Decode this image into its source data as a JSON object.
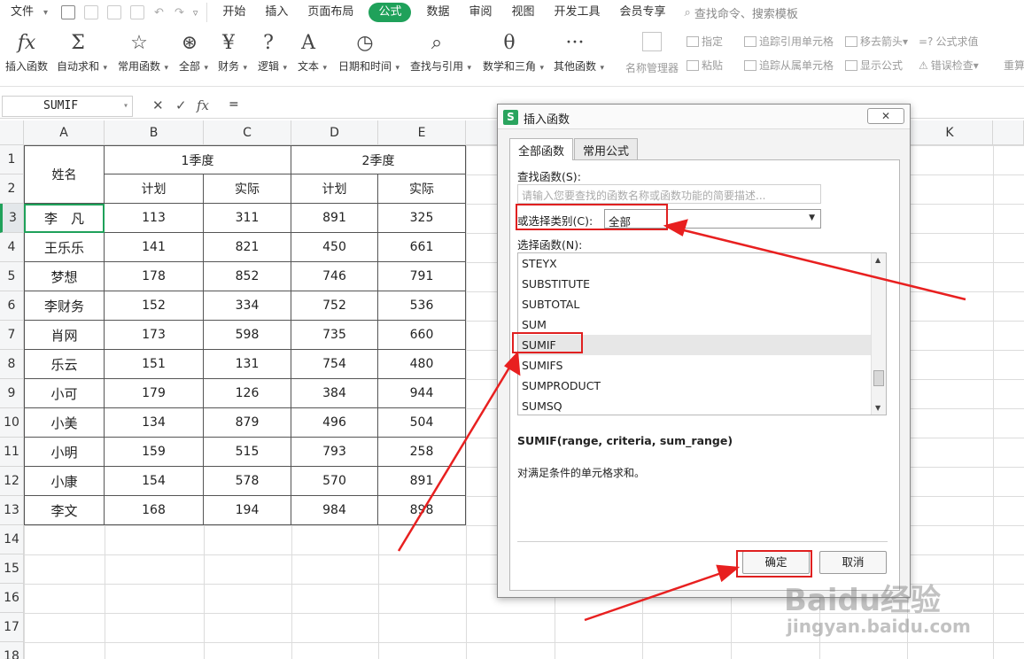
{
  "menubar": {
    "file": "文件",
    "tabs": [
      "开始",
      "插入",
      "页面布局",
      "公式",
      "数据",
      "审阅",
      "视图",
      "开发工具",
      "会员专享"
    ],
    "active_tab": "公式",
    "search": "查找命令、搜索模板"
  },
  "ribbon": {
    "buttons": [
      {
        "icon": "fx",
        "label": "插入函数"
      },
      {
        "icon": "Σ",
        "label": "自动求和"
      },
      {
        "icon": "☆",
        "label": "常用函数"
      },
      {
        "icon": "⊛",
        "label": "全部"
      },
      {
        "icon": "¥",
        "label": "财务"
      },
      {
        "icon": "?",
        "label": "逻辑"
      },
      {
        "icon": "A",
        "label": "文本"
      },
      {
        "icon": "◷",
        "label": "日期和时间"
      },
      {
        "icon": "⌕",
        "label": "查找与引用"
      },
      {
        "icon": "θ",
        "label": "数学和三角"
      },
      {
        "icon": "···",
        "label": "其他函数"
      }
    ],
    "name_manager": "名称管理器",
    "specify": "指定",
    "paste": "粘贴",
    "trace_precedents": "追踪引用单元格",
    "trace_dependents": "追踪从属单元格",
    "remove_arrows": "移去箭头",
    "show_formulas": "显示公式",
    "evaluate": "公式求值",
    "error_check": "错误检查",
    "recalc": "重算"
  },
  "formula_bar": {
    "name_box": "SUMIF",
    "value": "="
  },
  "sheet": {
    "columns": [
      "A",
      "B",
      "C",
      "D",
      "E",
      "K"
    ],
    "rows": [
      "1",
      "2",
      "3",
      "4",
      "5",
      "6",
      "7",
      "8",
      "9",
      "10",
      "11",
      "12",
      "13",
      "14",
      "15",
      "16",
      "17",
      "18"
    ],
    "header_name": "姓名",
    "q1": "1季度",
    "q2": "2季度",
    "plan": "计划",
    "actual": "实际",
    "data": [
      [
        "李　凡",
        "113",
        "311",
        "891",
        "325"
      ],
      [
        "王乐乐",
        "141",
        "821",
        "450",
        "661"
      ],
      [
        "梦想",
        "178",
        "852",
        "746",
        "791"
      ],
      [
        "李财务",
        "152",
        "334",
        "752",
        "536"
      ],
      [
        "肖网",
        "173",
        "598",
        "735",
        "660"
      ],
      [
        "乐云",
        "151",
        "131",
        "754",
        "480"
      ],
      [
        "小可",
        "179",
        "126",
        "384",
        "944"
      ],
      [
        "小美",
        "134",
        "879",
        "496",
        "504"
      ],
      [
        "小明",
        "159",
        "515",
        "793",
        "258"
      ],
      [
        "小康",
        "154",
        "578",
        "570",
        "891"
      ],
      [
        "李文",
        "168",
        "194",
        "984",
        "898"
      ]
    ]
  },
  "dialog": {
    "title": "插入函数",
    "tab_all": "全部函数",
    "tab_common": "常用公式",
    "search_label": "查找函数(S):",
    "search_placeholder": "请输入您要查找的函数名称或函数功能的简要描述...",
    "category_label": "或选择类别(C):",
    "category_value": "全部",
    "list_label": "选择函数(N):",
    "functions": [
      "STEYX",
      "SUBSTITUTE",
      "SUBTOTAL",
      "SUM",
      "SUMIF",
      "SUMIFS",
      "SUMPRODUCT",
      "SUMSQ"
    ],
    "selected": "SUMIF",
    "signature": "SUMIF(range, criteria, sum_range)",
    "description": "对满足条件的单元格求和。",
    "ok": "确定",
    "cancel": "取消"
  },
  "watermark": {
    "brand": "Baidu经验",
    "url": "jingyan.baidu.com"
  },
  "colors": {
    "accent": "#1fa15a",
    "highlight": "#e02020"
  }
}
